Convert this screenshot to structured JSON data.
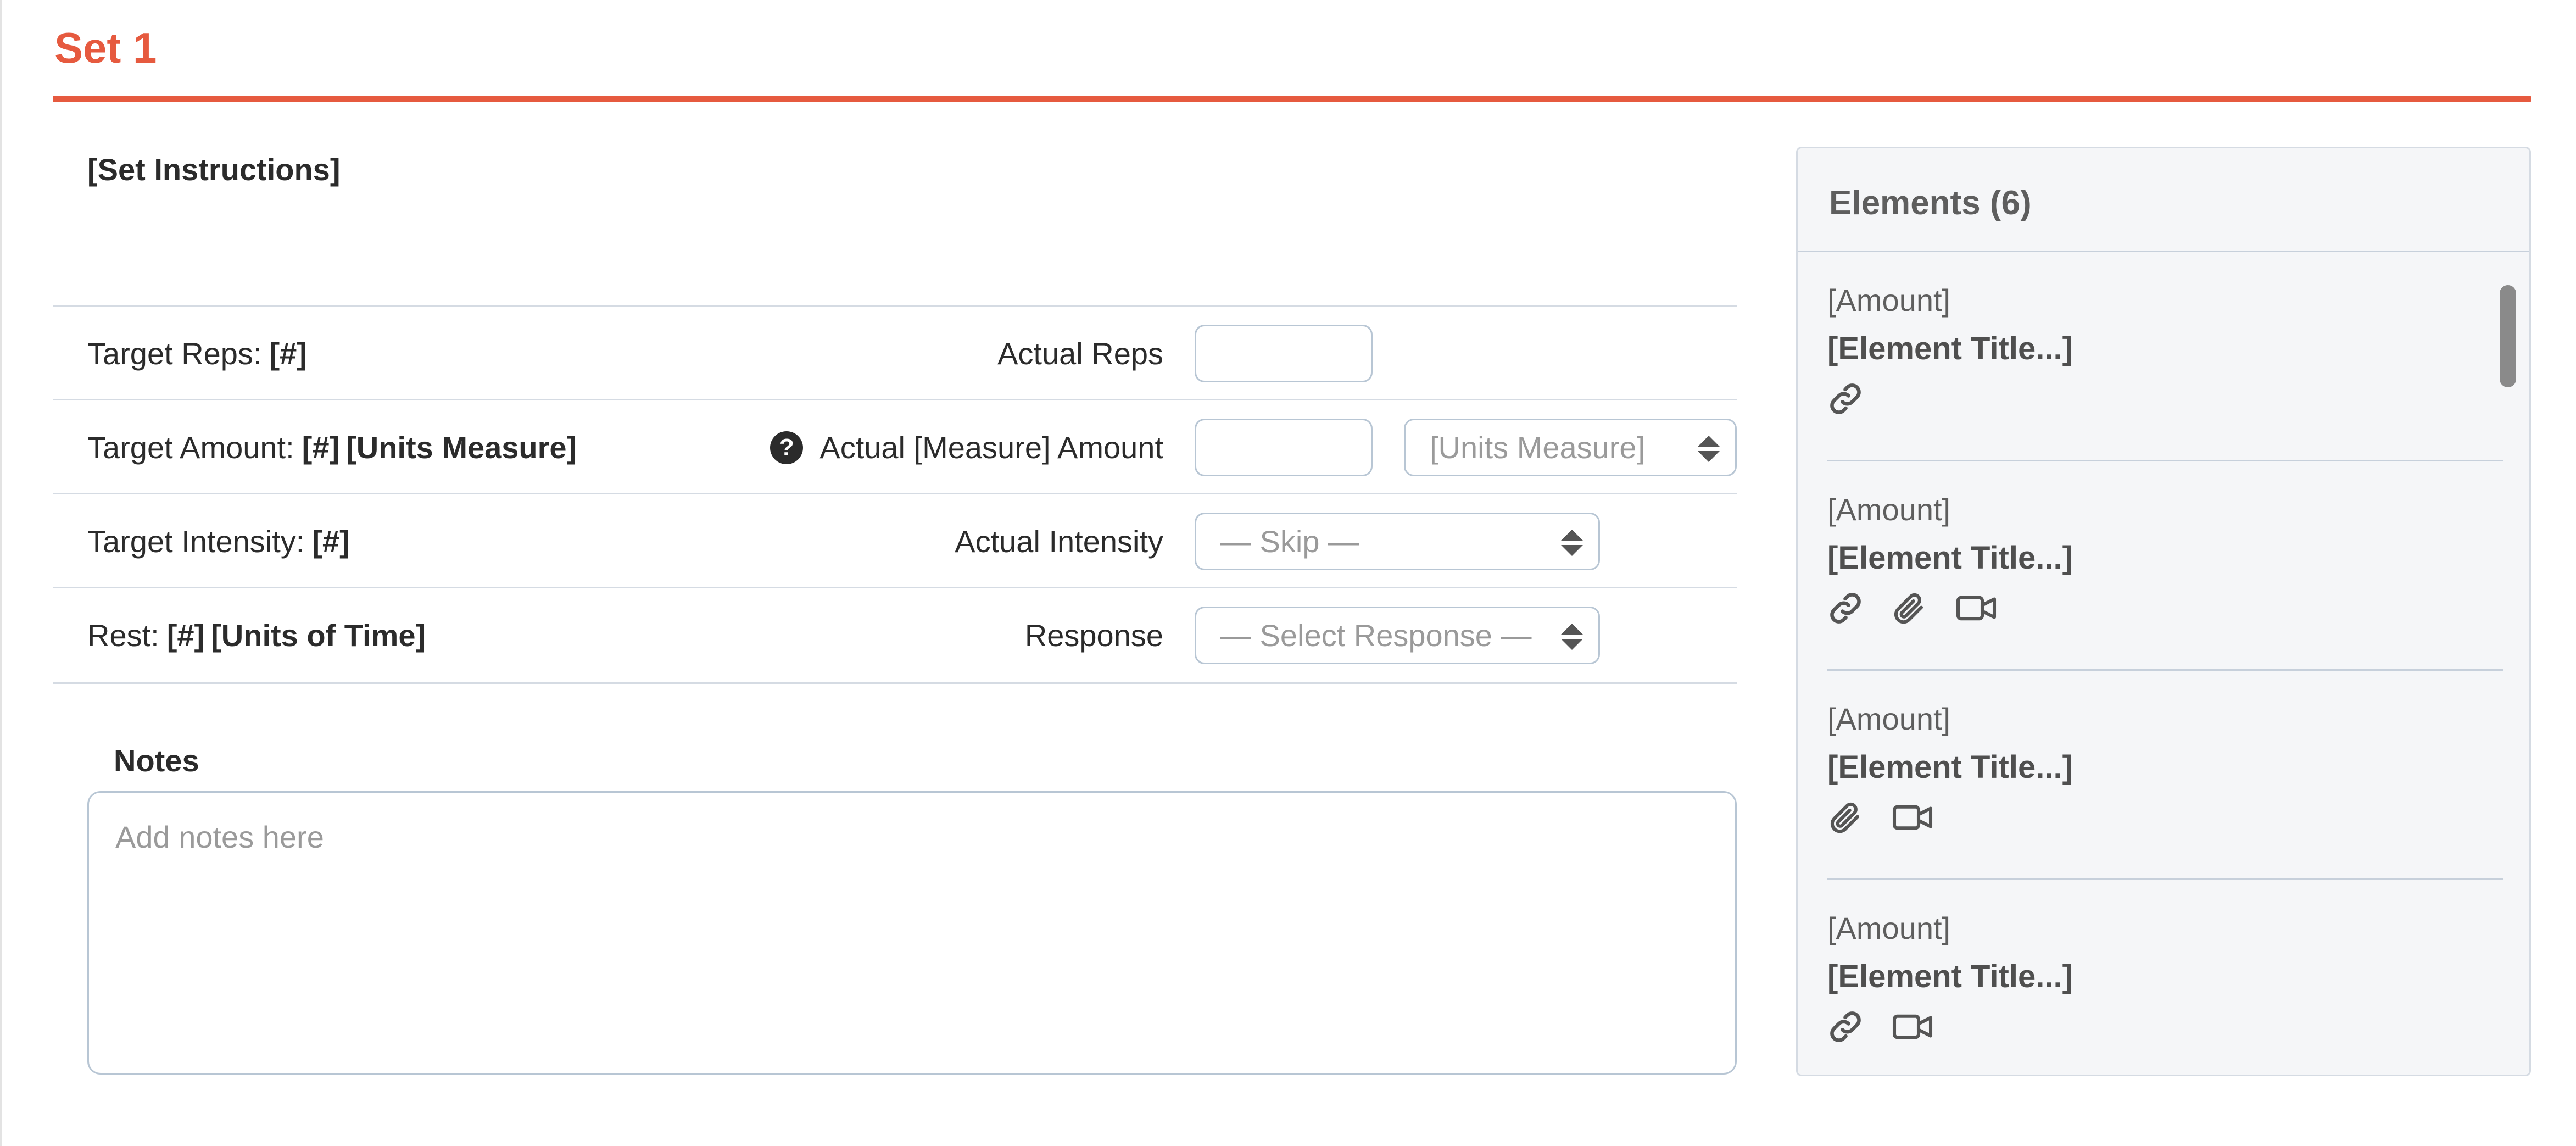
{
  "set": {
    "title": "Set 1",
    "instructions": "[Set Instructions]"
  },
  "rows": [
    {
      "target_label": "Target Reps:",
      "target_value": "[#]",
      "actual_label": "Actual Reps",
      "actual_value": ""
    },
    {
      "target_label": "Target Amount:",
      "target_value": "[#]",
      "target_units": "[Units Measure]",
      "actual_label": "Actual [Measure] Amount",
      "actual_value": "",
      "units_select": "[Units Measure]",
      "help_icon": "question-circle-icon"
    },
    {
      "target_label": "Target Intensity:",
      "target_value": "[#]",
      "actual_label": "Actual Intensity",
      "select_value": "— Skip —"
    },
    {
      "target_label": "Rest:",
      "target_value": "[#]",
      "target_units": "[Units of Time]",
      "actual_label": "Response",
      "select_value": "— Select Response —"
    }
  ],
  "notes": {
    "label": "Notes",
    "placeholder": "Add notes here",
    "value": ""
  },
  "elements_panel": {
    "title": "Elements (6)",
    "items": [
      {
        "amount": "[Amount]",
        "title": "[Element Title...]",
        "icons": [
          "link-icon"
        ]
      },
      {
        "amount": "[Amount]",
        "title": "[Element Title...]",
        "icons": [
          "link-icon",
          "paperclip-icon",
          "video-icon"
        ]
      },
      {
        "amount": "[Amount]",
        "title": "[Element Title...]",
        "icons": [
          "paperclip-icon",
          "video-icon"
        ]
      },
      {
        "amount": "[Amount]",
        "title": "[Element Title...]",
        "icons": [
          "link-icon",
          "video-icon"
        ]
      }
    ]
  },
  "colors": {
    "accent": "#e65a3f",
    "border": "#b8c6d4",
    "panel_bg": "#f5f6f8"
  }
}
